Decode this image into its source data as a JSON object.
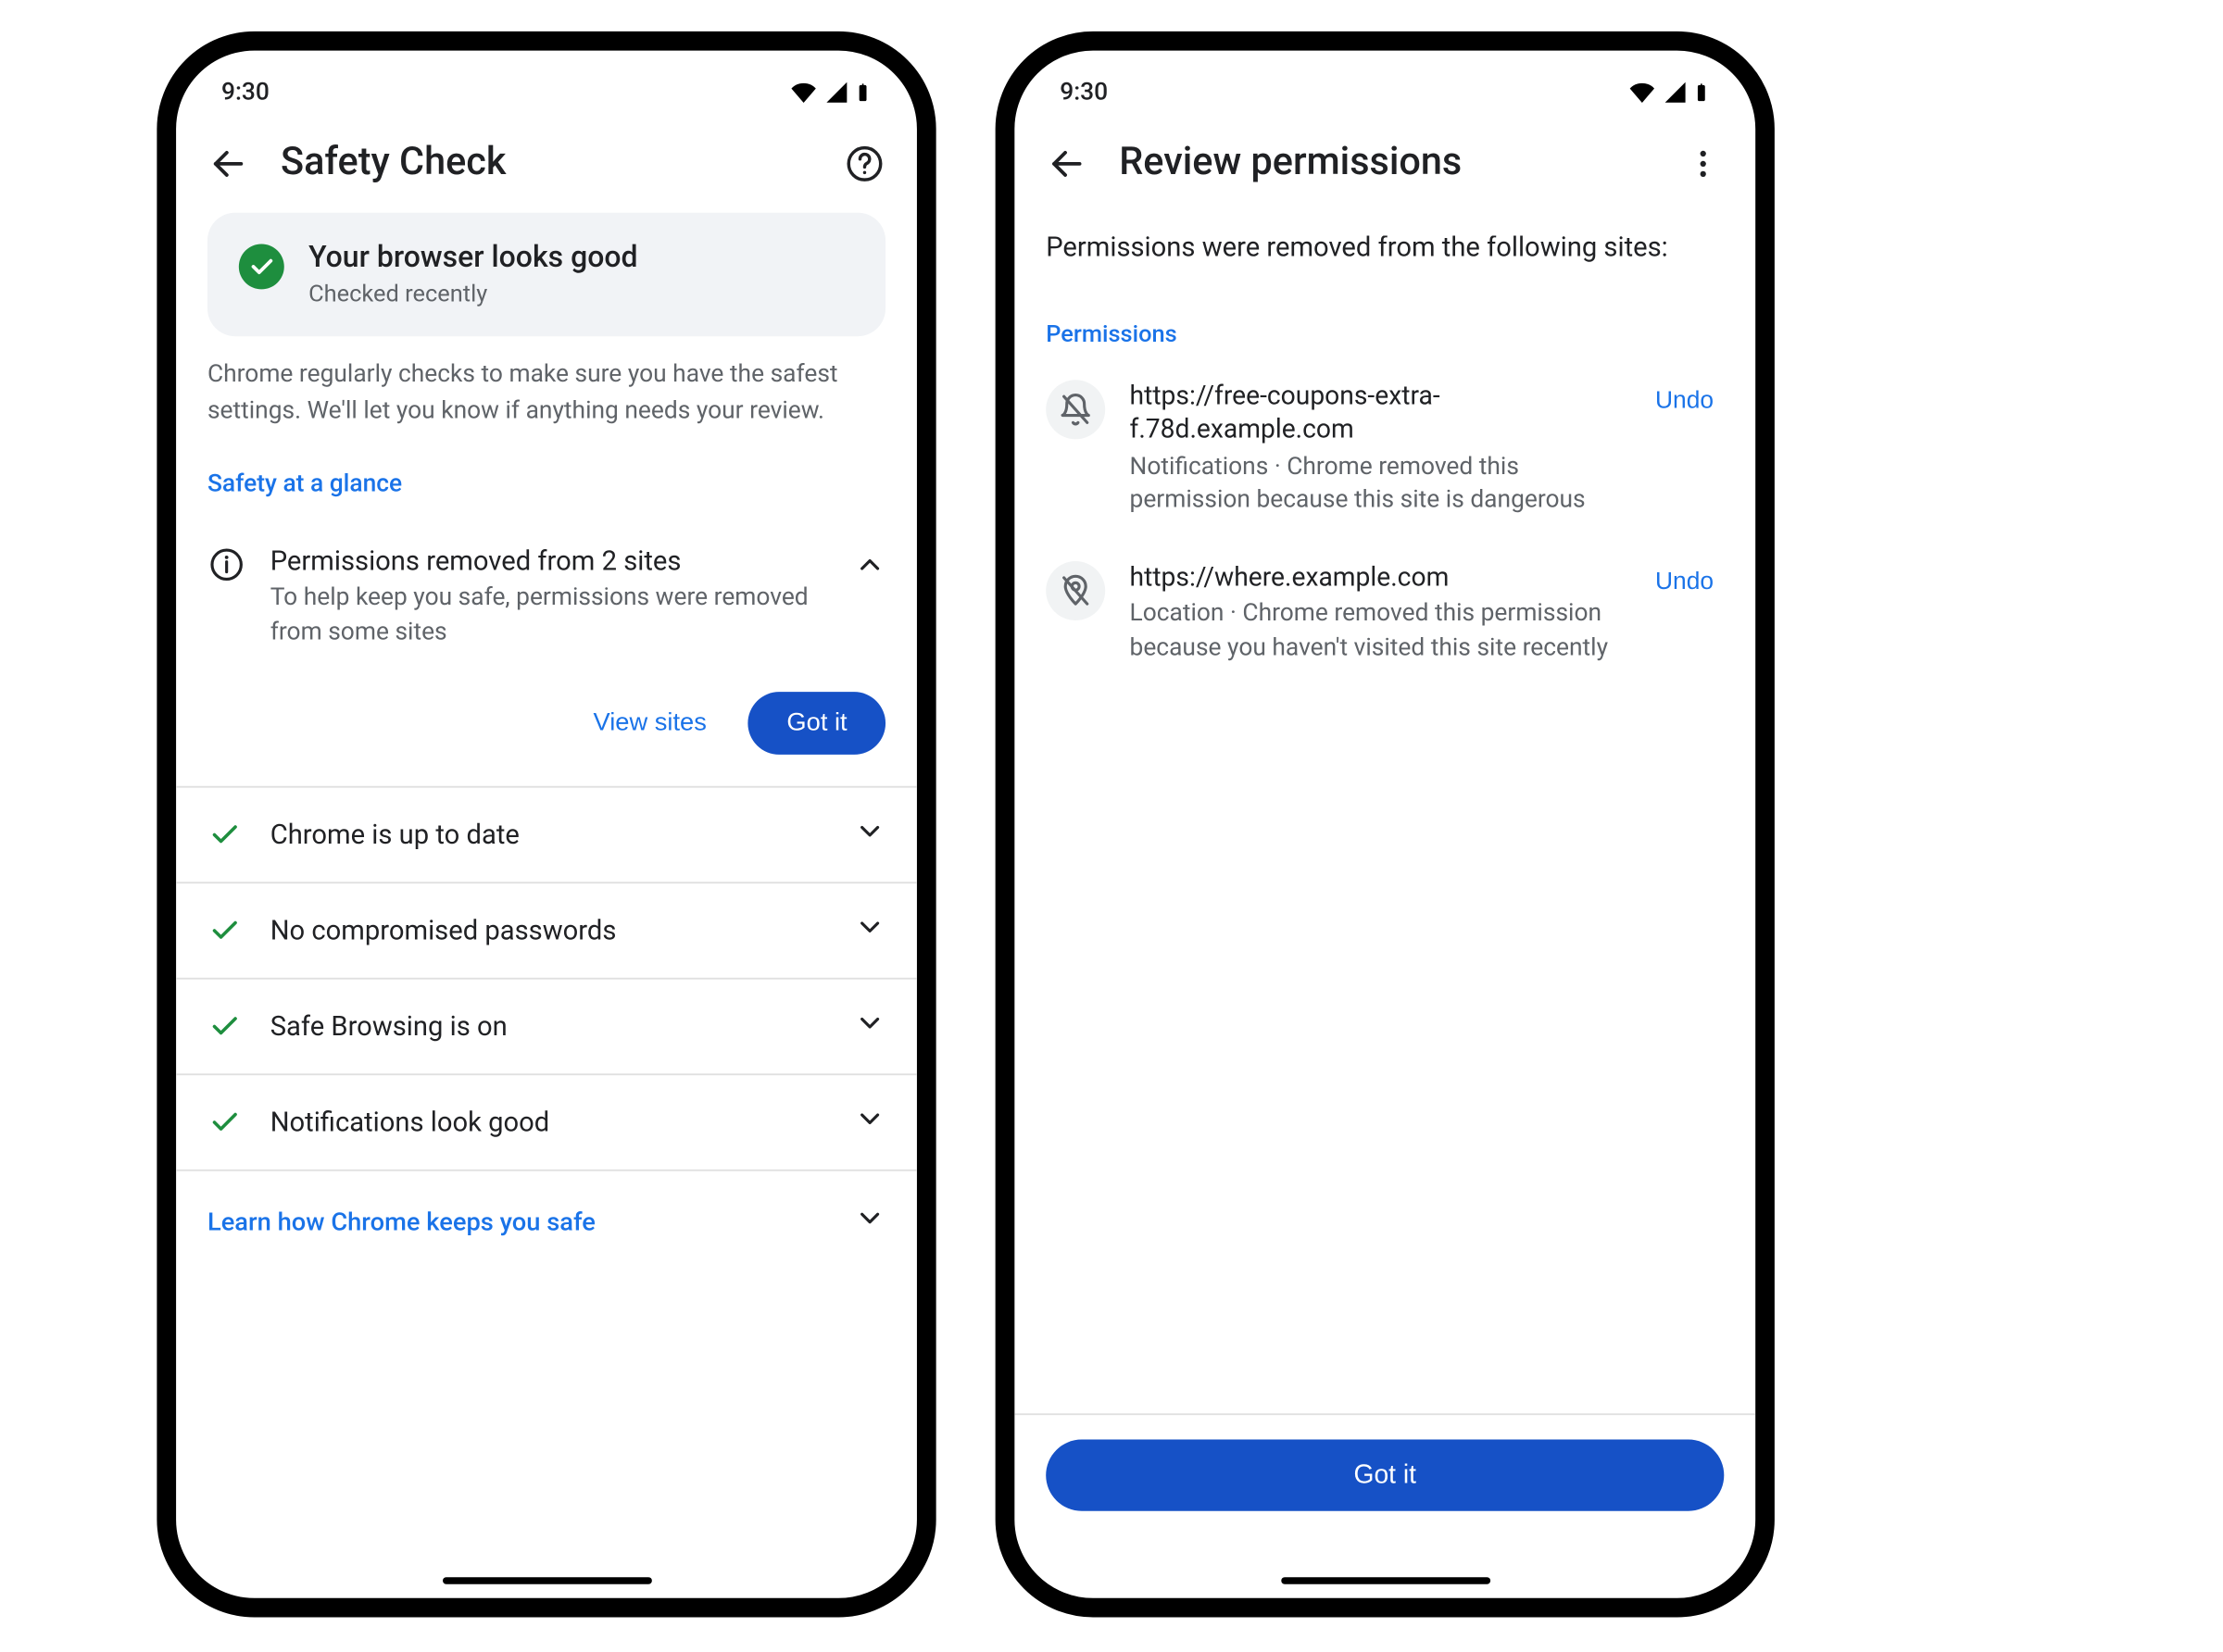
{
  "status_time": "9:30",
  "phone1": {
    "title": "Safety Check",
    "summary": {
      "title": "Your browser looks good",
      "subtitle": "Checked recently"
    },
    "description": "Chrome regularly checks to make sure you have the safest settings. We'll let you know if anything needs your review.",
    "glance_label": "Safety at a glance",
    "permissions": {
      "title": "Permissions removed from 2 sites",
      "subtitle": "To help keep you safe, permissions were removed from some sites",
      "view_sites_label": "View sites",
      "got_it_label": "Got it"
    },
    "checks": [
      {
        "label": "Chrome is up to date"
      },
      {
        "label": "No compromised passwords"
      },
      {
        "label": "Safe Browsing is on"
      },
      {
        "label": "Notifications look good"
      }
    ],
    "learn_more_label": "Learn how Chrome keeps you safe"
  },
  "phone2": {
    "title": "Review permissions",
    "intro": "Permissions were removed from the following sites:",
    "section_label": "Permissions",
    "sites": [
      {
        "icon": "bell-off",
        "url": "https://free-coupons-extra-f.78d.example.com",
        "reason": "Notifications · Chrome removed this permission because this site is dangerous",
        "undo_label": "Undo"
      },
      {
        "icon": "location-off",
        "url": "https://where.example.com",
        "reason": "Location · Chrome removed this permission because you haven't visited this site recently",
        "undo_label": "Undo"
      }
    ],
    "got_it_label": "Got it"
  }
}
